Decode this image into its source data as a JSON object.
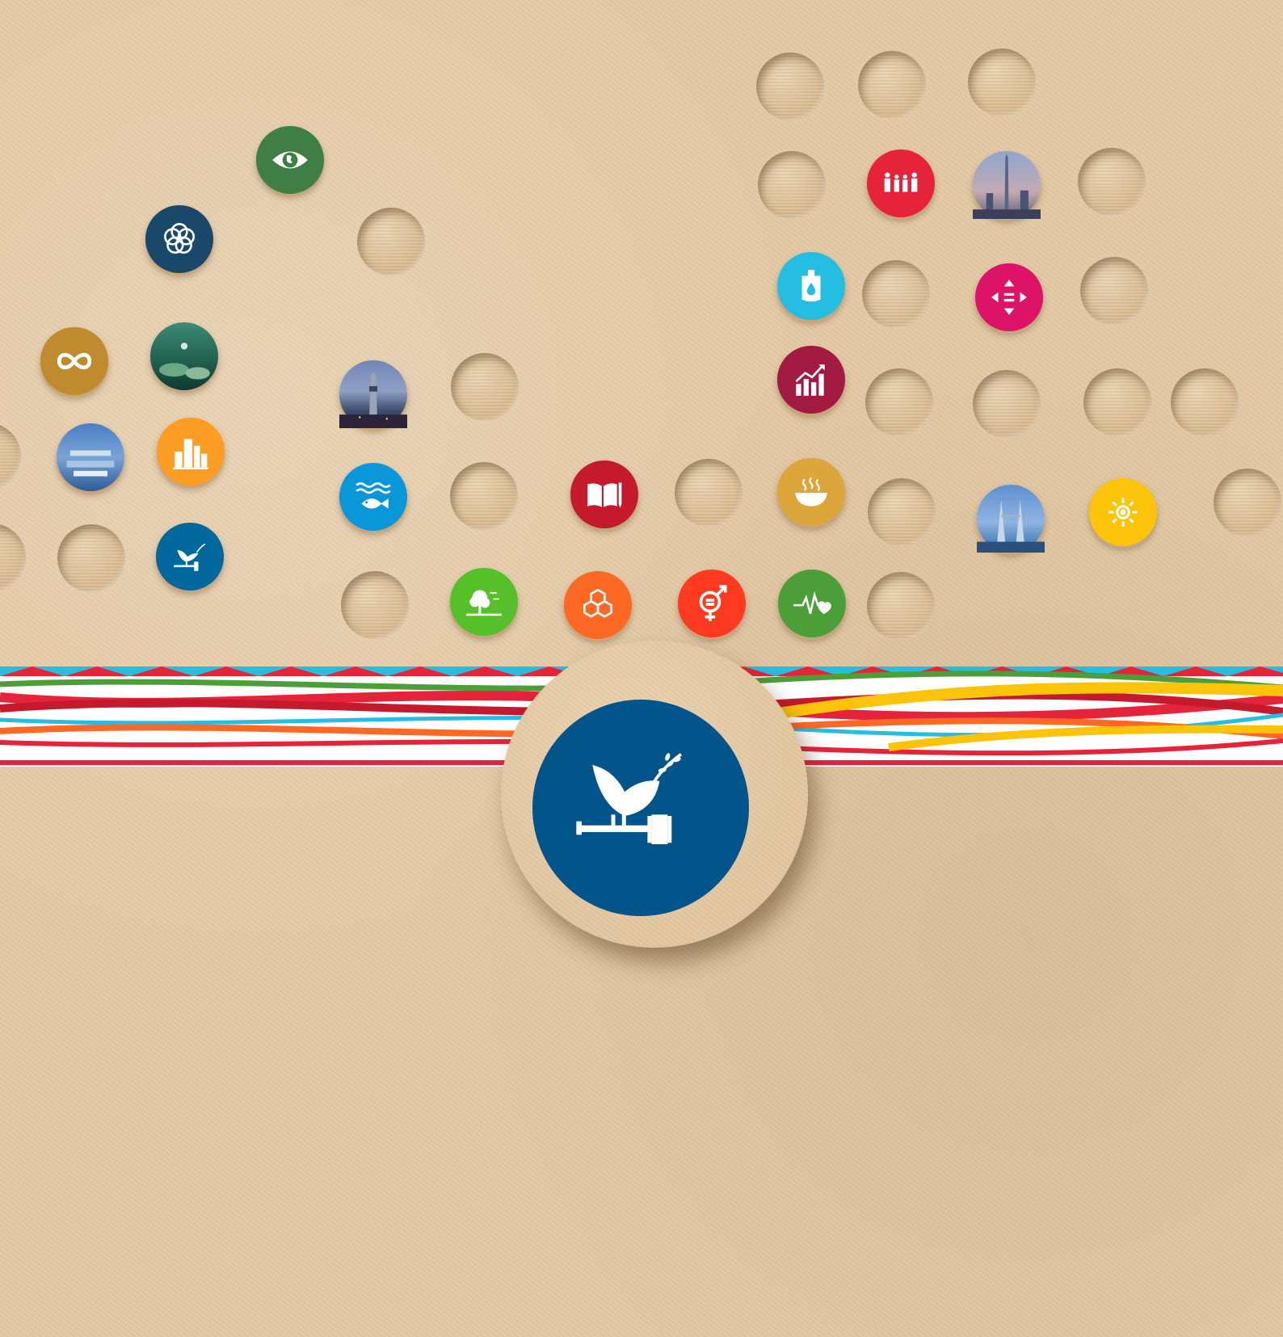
{
  "colors": {
    "paper": "#e3c8a3",
    "sdg1": "#e5243b",
    "sdg2": "#dda63a",
    "sdg3": "#4c9f38",
    "sdg4": "#c5192d",
    "sdg5": "#ff3a21",
    "sdg6": "#26bde2",
    "sdg7": "#fcc30b",
    "sdg8": "#a21942",
    "sdg9": "#fd6925",
    "sdg10": "#dd1367",
    "sdg11": "#fd9d24",
    "sdg12": "#bf8b2e",
    "sdg13": "#3f7e44",
    "sdg14": "#0a97d9",
    "sdg15": "#56c02b",
    "sdg16": "#00689d",
    "sdg17": "#19486a"
  },
  "featured_icon": "peace-dove-gavel-icon",
  "icons": [
    "eye-globe-icon",
    "flower-rings-icon",
    "infinity-loop-icon",
    "city-buildings-icon",
    "dove-gavel-icon",
    "fish-waves-icon",
    "open-book-pencil-icon",
    "tree-birds-icon",
    "cubes-icon",
    "gender-equality-icon",
    "heartbeat-icon",
    "steaming-bowl-icon",
    "growth-chart-icon",
    "water-drop-icon",
    "family-icon",
    "equality-arrows-icon",
    "sun-icon"
  ],
  "photos": [
    "coral-reef-photo",
    "cityscape-photo",
    "tower-photo",
    "skyscraper-photo",
    "twin-towers-photo"
  ]
}
